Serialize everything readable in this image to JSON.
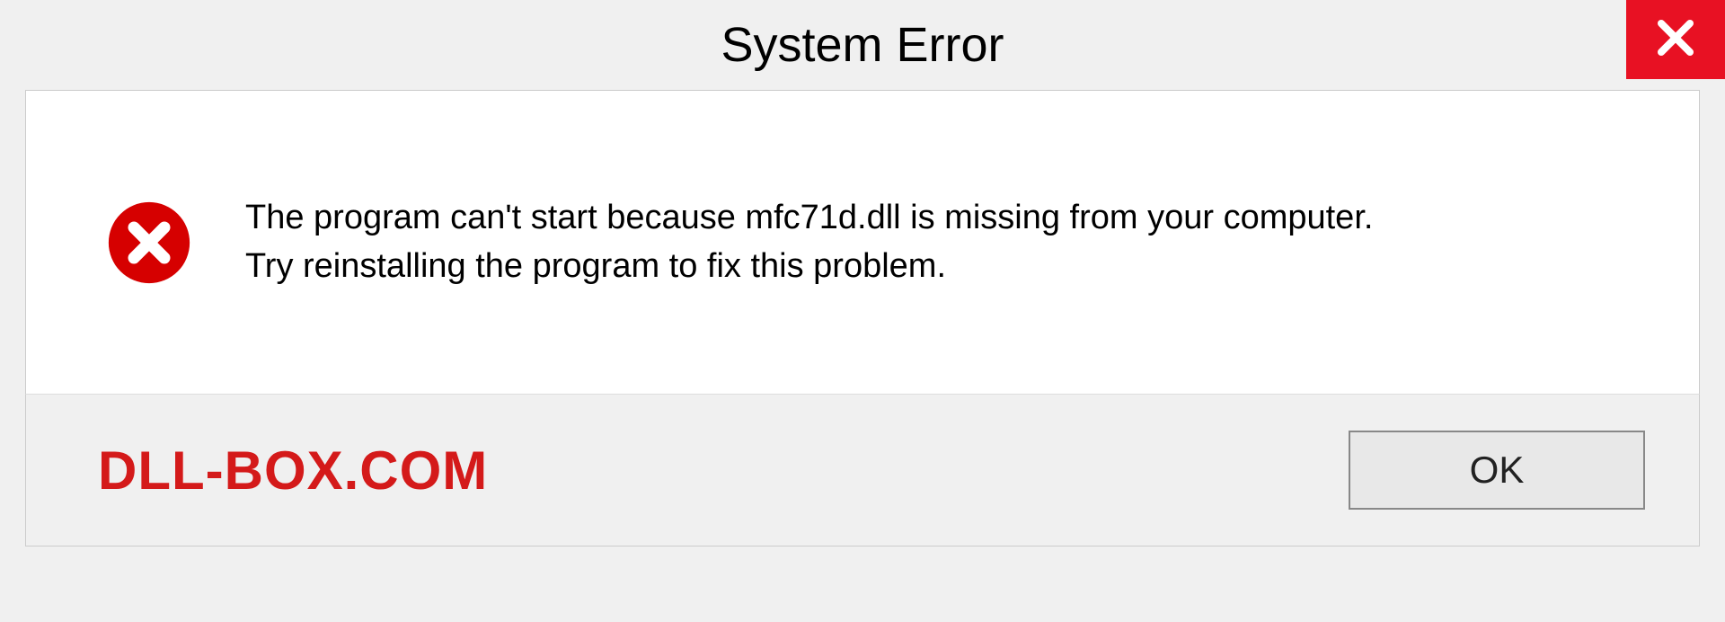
{
  "title": "System Error",
  "message": {
    "line1": "The program can't start because mfc71d.dll is missing from your computer.",
    "line2": "Try reinstalling the program to fix this problem."
  },
  "watermark": "DLL-BOX.COM",
  "buttons": {
    "ok": "OK"
  }
}
